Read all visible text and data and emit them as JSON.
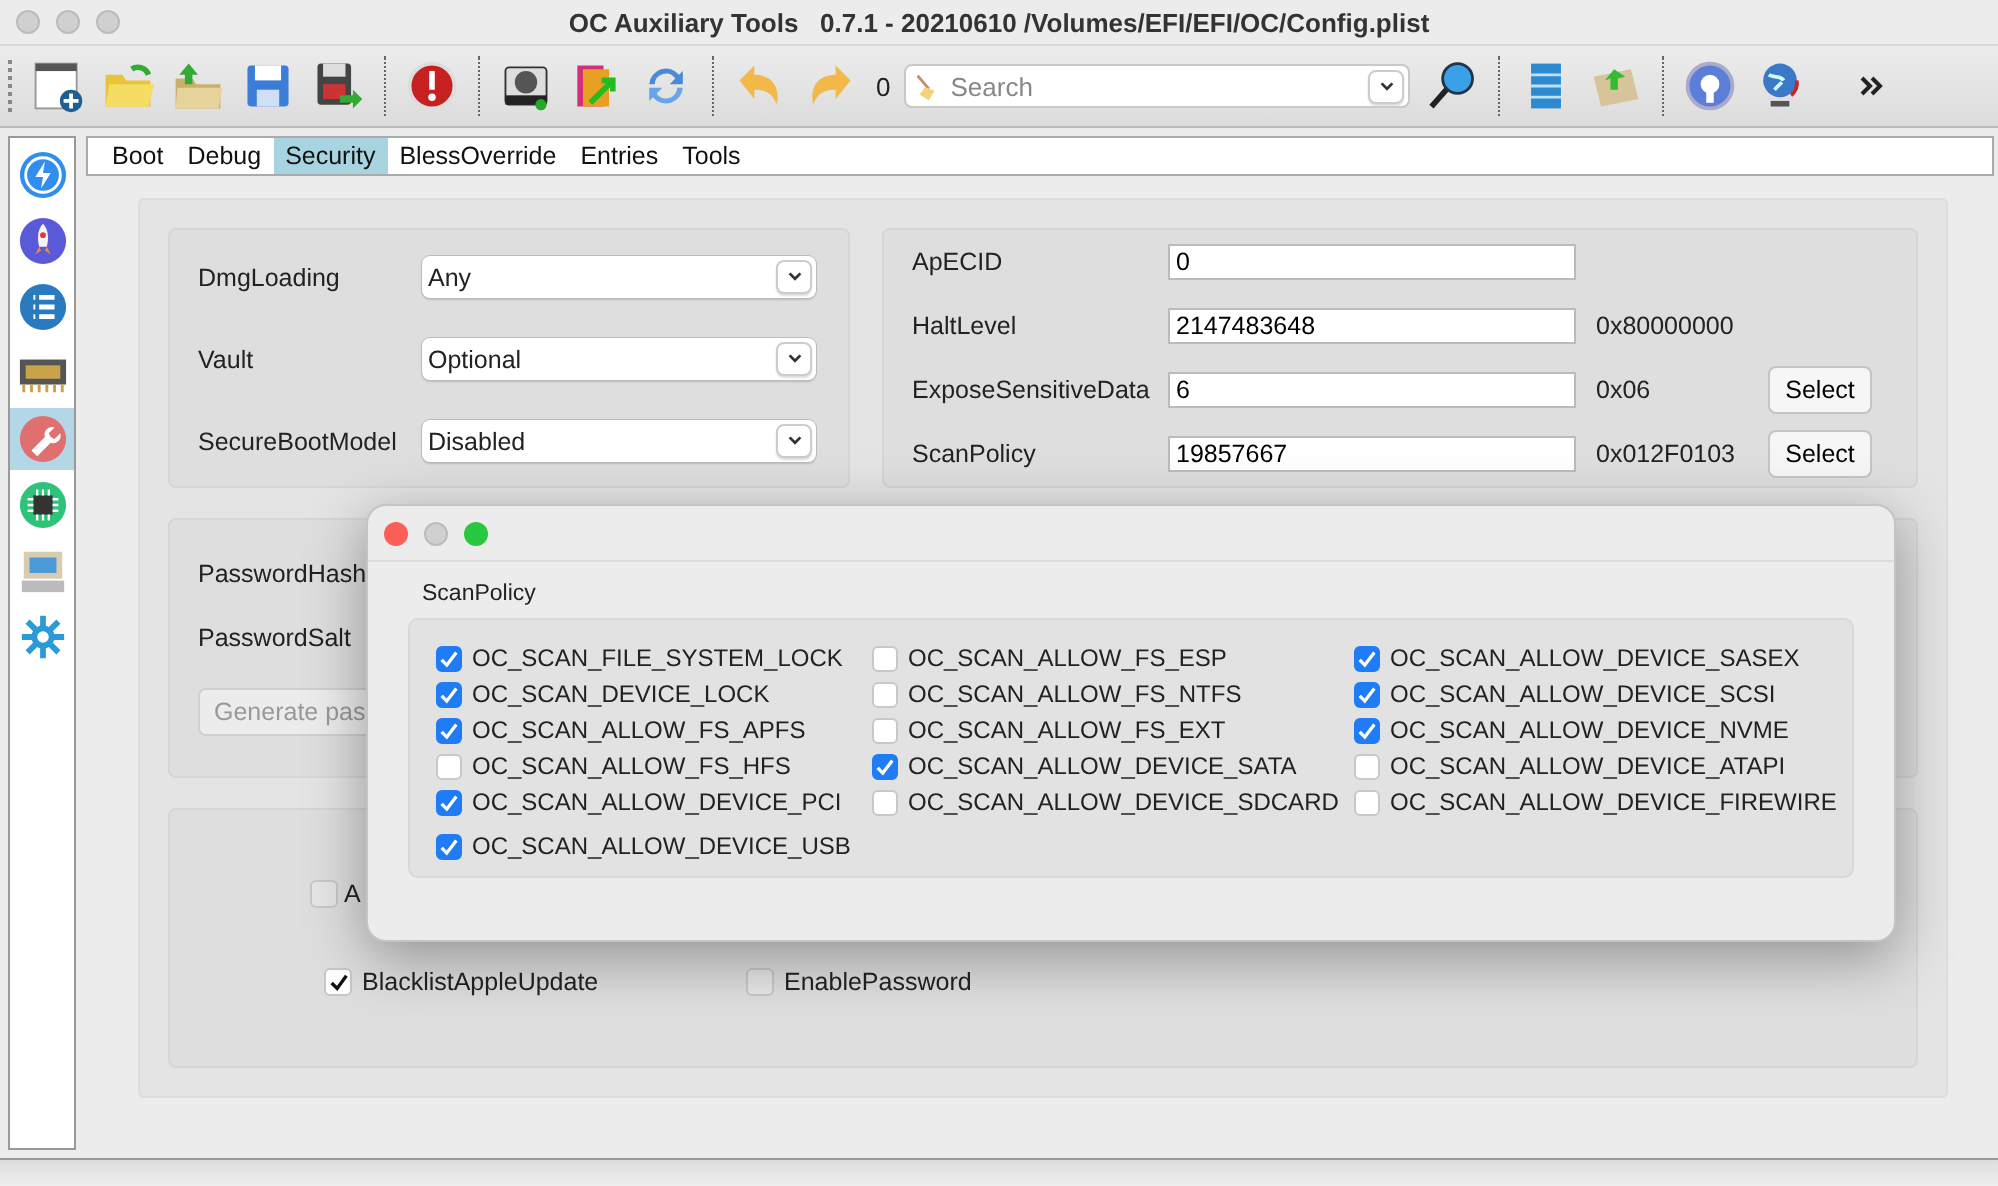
{
  "window": {
    "title": "OC Auxiliary Tools   0.7.1 - 20210610 /Volumes/EFI/EFI/OC/Config.plist"
  },
  "toolbar": {
    "counter": "0",
    "search": {
      "placeholder": "Search"
    }
  },
  "sidebar": {
    "items": [
      {
        "selected": false
      },
      {
        "selected": false
      },
      {
        "selected": false
      },
      {
        "selected": false
      },
      {
        "selected": true
      },
      {
        "selected": false
      },
      {
        "selected": false
      },
      {
        "selected": false
      }
    ]
  },
  "tabs": [
    {
      "label": "Boot",
      "selected": false
    },
    {
      "label": "Debug",
      "selected": false
    },
    {
      "label": "Security",
      "selected": true
    },
    {
      "label": "BlessOverride",
      "selected": false
    },
    {
      "label": "Entries",
      "selected": false
    },
    {
      "label": "Tools",
      "selected": false
    }
  ],
  "security": {
    "dropdowns": [
      {
        "label": "DmgLoading",
        "value": "Any"
      },
      {
        "label": "Vault",
        "value": "Optional"
      },
      {
        "label": "SecureBootModel",
        "value": "Disabled"
      }
    ],
    "fields": [
      {
        "label": "ApECID",
        "value": "0"
      },
      {
        "label": "HaltLevel",
        "value": "2147483648",
        "hex": "0x80000000"
      },
      {
        "label": "ExposeSensitiveData",
        "value": "6",
        "hex": "0x06",
        "button": "Select"
      },
      {
        "label": "ScanPolicy",
        "value": "19857667",
        "hex": "0x012F0103",
        "button": "Select"
      }
    ],
    "password": {
      "hash_label": "PasswordHash",
      "salt_label": "PasswordSalt",
      "generate_button": "Generate pas"
    },
    "checkboxes": [
      {
        "label": "A",
        "checked": false
      },
      {
        "label": "BlacklistAppleUpdate",
        "checked": true
      },
      {
        "label": "EnablePassword",
        "checked": false
      }
    ]
  },
  "dialog": {
    "title": "ScanPolicy",
    "options": [
      {
        "label": "OC_SCAN_FILE_SYSTEM_LOCK",
        "checked": true
      },
      {
        "label": "OC_SCAN_ALLOW_FS_ESP",
        "checked": false
      },
      {
        "label": "OC_SCAN_ALLOW_DEVICE_SASEX",
        "checked": true
      },
      {
        "label": "OC_SCAN_DEVICE_LOCK",
        "checked": true
      },
      {
        "label": "OC_SCAN_ALLOW_FS_NTFS",
        "checked": false
      },
      {
        "label": "OC_SCAN_ALLOW_DEVICE_SCSI",
        "checked": true
      },
      {
        "label": "OC_SCAN_ALLOW_FS_APFS",
        "checked": true
      },
      {
        "label": "OC_SCAN_ALLOW_FS_EXT",
        "checked": false
      },
      {
        "label": "OC_SCAN_ALLOW_DEVICE_NVME",
        "checked": true
      },
      {
        "label": "OC_SCAN_ALLOW_FS_HFS",
        "checked": false
      },
      {
        "label": "OC_SCAN_ALLOW_DEVICE_SATA",
        "checked": true
      },
      {
        "label": "OC_SCAN_ALLOW_DEVICE_ATAPI",
        "checked": false
      },
      {
        "label": "OC_SCAN_ALLOW_DEVICE_PCI",
        "checked": true
      },
      {
        "label": "OC_SCAN_ALLOW_DEVICE_SDCARD",
        "checked": false
      },
      {
        "label": "OC_SCAN_ALLOW_DEVICE_FIREWIRE",
        "checked": false
      },
      {
        "label": "OC_SCAN_ALLOW_DEVICE_USB",
        "checked": true
      }
    ]
  }
}
